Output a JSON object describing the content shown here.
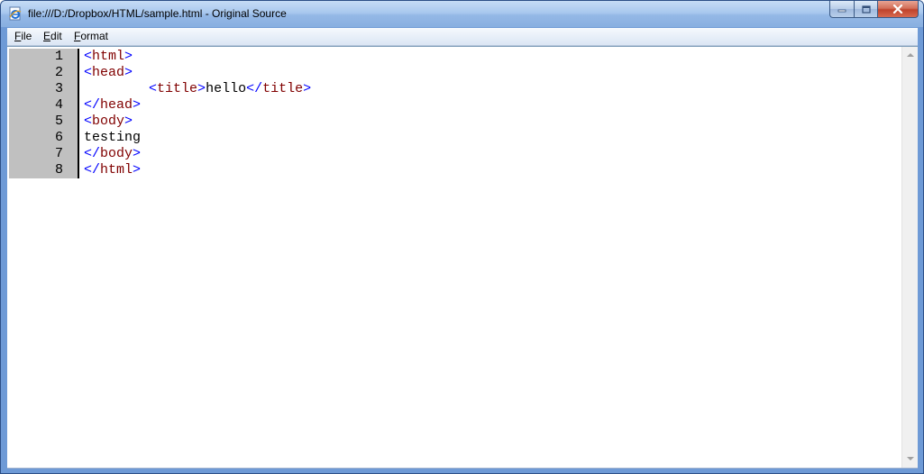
{
  "window": {
    "title": "file:///D:/Dropbox/HTML/sample.html - Original Source"
  },
  "menu": {
    "items": [
      "File",
      "Edit",
      "Format"
    ]
  },
  "editor": {
    "lines": [
      {
        "number": "1",
        "parts": [
          {
            "t": "<",
            "c": "b"
          },
          {
            "t": "html",
            "c": "n"
          },
          {
            "t": ">",
            "c": "b"
          }
        ]
      },
      {
        "number": "2",
        "parts": [
          {
            "t": "<",
            "c": "b"
          },
          {
            "t": "head",
            "c": "n"
          },
          {
            "t": ">",
            "c": "b"
          }
        ]
      },
      {
        "number": "3",
        "parts": [
          {
            "t": "        ",
            "c": "x"
          },
          {
            "t": "<",
            "c": "b"
          },
          {
            "t": "title",
            "c": "n"
          },
          {
            "t": ">",
            "c": "b"
          },
          {
            "t": "hello",
            "c": "x"
          },
          {
            "t": "</",
            "c": "b"
          },
          {
            "t": "title",
            "c": "n"
          },
          {
            "t": ">",
            "c": "b"
          }
        ]
      },
      {
        "number": "4",
        "parts": [
          {
            "t": "</",
            "c": "b"
          },
          {
            "t": "head",
            "c": "n"
          },
          {
            "t": ">",
            "c": "b"
          }
        ]
      },
      {
        "number": "5",
        "parts": [
          {
            "t": "<",
            "c": "b"
          },
          {
            "t": "body",
            "c": "n"
          },
          {
            "t": ">",
            "c": "b"
          }
        ]
      },
      {
        "number": "6",
        "parts": [
          {
            "t": "testing",
            "c": "x"
          }
        ]
      },
      {
        "number": "7",
        "parts": [
          {
            "t": "</",
            "c": "b"
          },
          {
            "t": "body",
            "c": "n"
          },
          {
            "t": ">",
            "c": "b"
          }
        ]
      },
      {
        "number": "8",
        "parts": [
          {
            "t": "</",
            "c": "b"
          },
          {
            "t": "html",
            "c": "n"
          },
          {
            "t": ">",
            "c": "b"
          }
        ]
      }
    ]
  },
  "colors": {
    "tag_bracket": "#0000ff",
    "tag_name": "#800000",
    "text": "#000000",
    "gutter": "#c0c0c0"
  },
  "icons": [
    "ie-document-icon",
    "minimize-icon",
    "maximize-icon",
    "close-icon",
    "scroll-up-arrow-icon",
    "scroll-down-arrow-icon"
  ]
}
